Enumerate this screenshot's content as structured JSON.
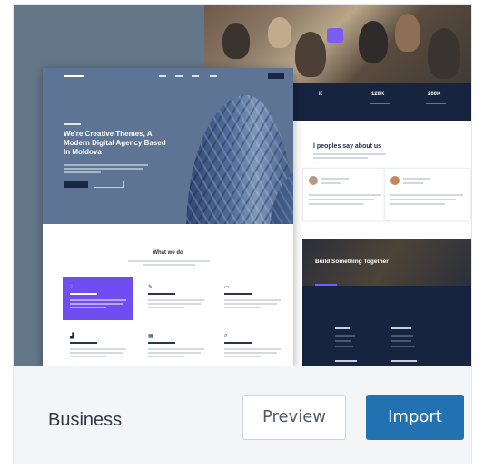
{
  "theme": {
    "name": "Business"
  },
  "actions": {
    "preview_label": "Preview",
    "import_label": "Import"
  },
  "preview_thumbnail": {
    "front_page": {
      "headline": "We're Creative Themes, A Modern Digital Agency Based In Moldova",
      "section_title": "What we do"
    },
    "back_page": {
      "stats": [
        "K",
        "120K",
        "200K"
      ],
      "testimonials_title": "l peoples say about us",
      "cta_title": "Build Something Together"
    }
  },
  "colors": {
    "import_button": "#2271b1",
    "accent_purple": "#6f4df0",
    "navy": "#16243f"
  }
}
